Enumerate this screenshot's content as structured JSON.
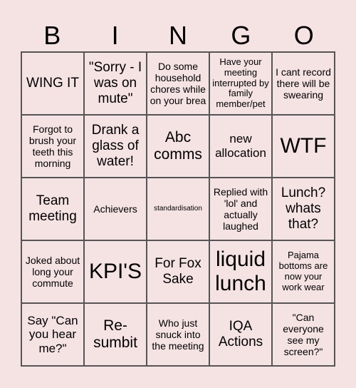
{
  "header": {
    "letters": [
      "B",
      "I",
      "N",
      "G",
      "O"
    ]
  },
  "cells": [
    {
      "text": "WING IT",
      "size": "s5"
    },
    {
      "text": "\"Sorry - I was on mute\"",
      "size": "s5"
    },
    {
      "text": "Do some household chores while on your brea",
      "size": "s3"
    },
    {
      "text": "Have your meeting interrupted by family member/pet",
      "size": "s2"
    },
    {
      "text": "I cant record there will be swearing",
      "size": "s3"
    },
    {
      "text": "Forgot to brush your teeth this morning",
      "size": "s3"
    },
    {
      "text": "Drank a glass of water!",
      "size": "s5"
    },
    {
      "text": "Abc comms",
      "size": "s6"
    },
    {
      "text": "new allocation",
      "size": "s4"
    },
    {
      "text": "WTF",
      "size": "s7"
    },
    {
      "text": "Team meeting",
      "size": "s5"
    },
    {
      "text": "Achievers",
      "size": "s3"
    },
    {
      "text": "standardisation",
      "size": "s1"
    },
    {
      "text": "Replied with 'lol' and actually laughed",
      "size": "s3"
    },
    {
      "text": "Lunch? whats that?",
      "size": "s5"
    },
    {
      "text": "Joked about long your commute",
      "size": "s3"
    },
    {
      "text": "KPI'S",
      "size": "s7"
    },
    {
      "text": "For Fox Sake",
      "size": "s5"
    },
    {
      "text": "liquid lunch",
      "size": "s7"
    },
    {
      "text": "Pajama bottoms are now your work wear",
      "size": "s2"
    },
    {
      "text": "Say \"Can you hear me?\"",
      "size": "s4"
    },
    {
      "text": "Re-sumbit",
      "size": "s6"
    },
    {
      "text": "Who just snuck into the meeting",
      "size": "s3"
    },
    {
      "text": "IQA Actions",
      "size": "s5"
    },
    {
      "text": "\"Can everyone see my screen?\"",
      "size": "s3"
    }
  ]
}
